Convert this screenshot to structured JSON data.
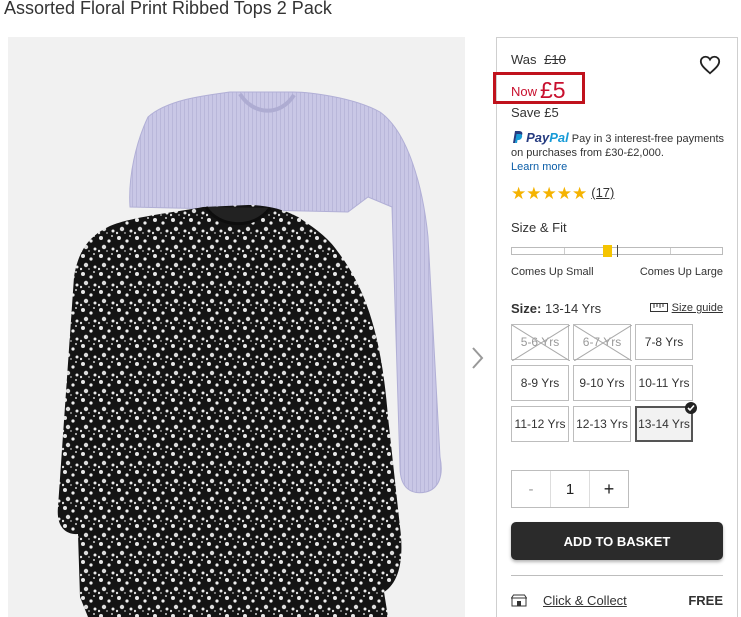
{
  "product": {
    "title": "Assorted Floral Print Ribbed Tops 2 Pack"
  },
  "pricing": {
    "was_label": "Was",
    "was_price": "£10",
    "now_label": "Now",
    "now_price": "£5",
    "save_label": "Save £5"
  },
  "paypal": {
    "brand_pay": "Pay",
    "brand_pal": "Pal",
    "message": "Pay in 3 interest-free payments on purchases from £30-£2,000.",
    "learn_more": "Learn more"
  },
  "rating": {
    "stars": 5,
    "reviews": "(17)"
  },
  "size_fit": {
    "heading": "Size & Fit",
    "left_label": "Comes Up Small",
    "right_label": "Comes Up Large",
    "fit_position": 0.45
  },
  "size": {
    "label": "Size:",
    "selected": "13-14 Yrs",
    "guide": "Size guide",
    "options": [
      {
        "label": "5-6 Yrs",
        "available": false
      },
      {
        "label": "6-7 Yrs",
        "available": false
      },
      {
        "label": "7-8 Yrs",
        "available": true
      },
      {
        "label": "8-9 Yrs",
        "available": true
      },
      {
        "label": "9-10 Yrs",
        "available": true
      },
      {
        "label": "10-11 Yrs",
        "available": true
      },
      {
        "label": "11-12 Yrs",
        "available": true
      },
      {
        "label": "12-13 Yrs",
        "available": true
      },
      {
        "label": "13-14 Yrs",
        "available": true
      }
    ]
  },
  "quantity": {
    "minus": "-",
    "value": "1",
    "plus": "+"
  },
  "basket": {
    "label": "ADD TO BASKET"
  },
  "delivery": {
    "click_collect": "Click & Collect",
    "price": "FREE"
  },
  "colors": {
    "sale_red": "#c8102e",
    "star_gold": "#f5b301",
    "paypal_blue": "#253b80",
    "paypal_light": "#179bd7",
    "button_dark": "#2b2b2b"
  },
  "icons": {
    "wishlist": "heart-icon",
    "next": "chevron-right-icon",
    "guide": "ruler-icon",
    "collect": "store-icon"
  }
}
